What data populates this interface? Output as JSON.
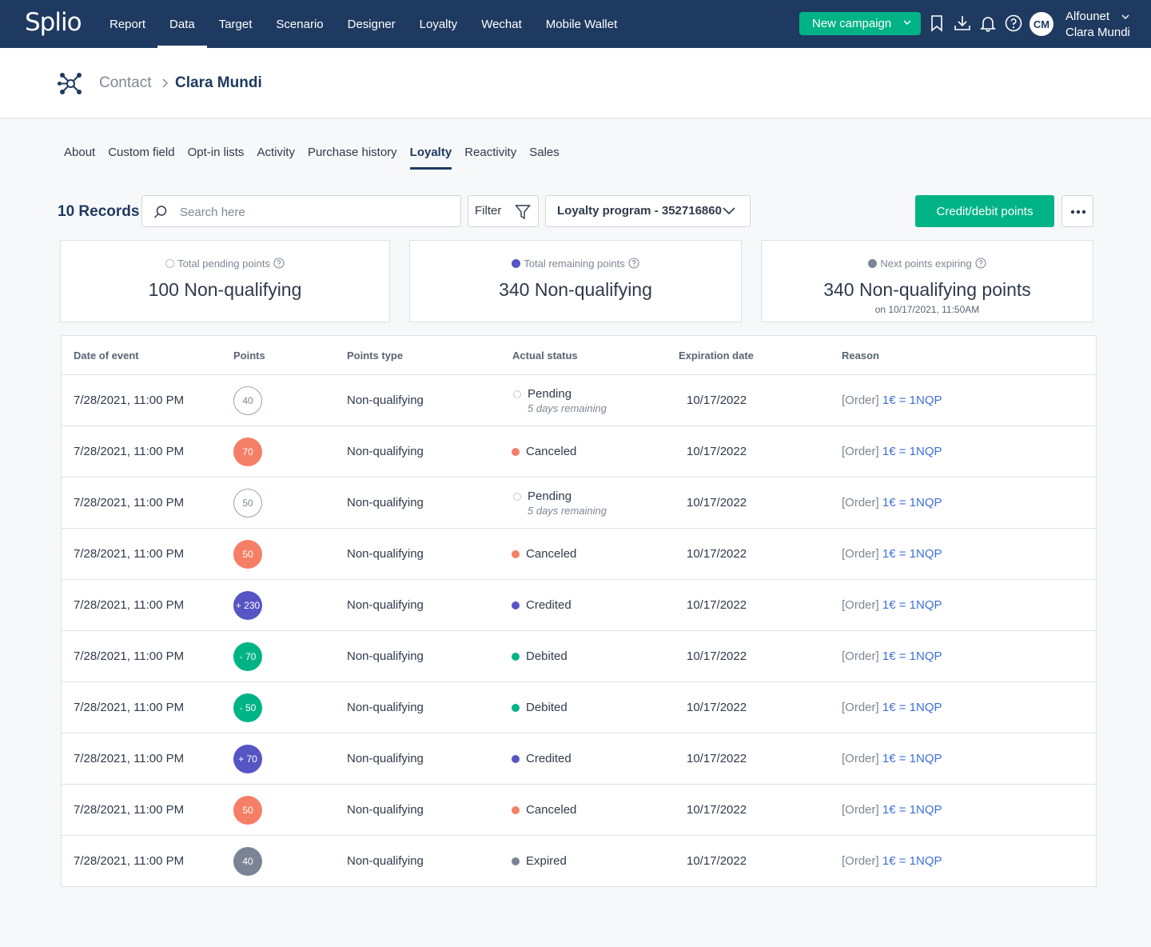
{
  "app": {
    "logo": "Splio"
  },
  "nav": {
    "items": [
      {
        "label": "Report",
        "active": false
      },
      {
        "label": "Data",
        "active": true
      },
      {
        "label": "Target",
        "active": false
      },
      {
        "label": "Scenario",
        "active": false
      },
      {
        "label": "Designer",
        "active": false
      },
      {
        "label": "Loyalty",
        "active": false
      },
      {
        "label": "Wechat",
        "active": false
      },
      {
        "label": "Mobile Wallet",
        "active": false
      }
    ],
    "new_campaign": "New campaign",
    "avatar_initials": "CM",
    "user_org": "Alfounet",
    "user_name": "Clara Mundi"
  },
  "breadcrumb": {
    "parent": "Contact",
    "current": "Clara Mundi"
  },
  "tabs": [
    {
      "label": "About",
      "active": false
    },
    {
      "label": "Custom field",
      "active": false
    },
    {
      "label": "Opt-in lists",
      "active": false
    },
    {
      "label": "Activity",
      "active": false
    },
    {
      "label": "Purchase history",
      "active": false
    },
    {
      "label": "Loyalty",
      "active": true
    },
    {
      "label": "Reactivity",
      "active": false
    },
    {
      "label": "Sales",
      "active": false
    }
  ],
  "toolbar": {
    "records": "10 Records",
    "search_placeholder": "Search here",
    "filter_label": "Filter",
    "program_label": "Loyalty program - 352716860",
    "credit_button": "Credit/debit points"
  },
  "cards": [
    {
      "label": "Total pending points",
      "value": "100 Non-qualifying",
      "sub": "",
      "dot": "pending"
    },
    {
      "label": "Total remaining points",
      "value": "340 Non-qualifying",
      "sub": "",
      "dot": "remaining"
    },
    {
      "label": "Next points expiring",
      "value": "340 Non-qualifying points",
      "sub": "on 10/17/2021, 11:50AM",
      "dot": "expiring"
    }
  ],
  "table": {
    "headers": [
      "Date of event",
      "Points",
      "Points type",
      "Actual status",
      "Expiration date",
      "Reason"
    ],
    "rows": [
      {
        "date": "7/28/2021, 11:00 PM",
        "points": "40",
        "kind": "pending",
        "type": "Non-qualifying",
        "status": "Pending",
        "status_sub": "5 days remaining",
        "expiration": "10/17/2022",
        "reason_prefix": "[Order]",
        "reason_link": "1€ = 1NQP"
      },
      {
        "date": "7/28/2021, 11:00 PM",
        "points": "70",
        "kind": "canceled",
        "type": "Non-qualifying",
        "status": "Canceled",
        "status_sub": "",
        "expiration": "10/17/2022",
        "reason_prefix": "[Order]",
        "reason_link": "1€ = 1NQP"
      },
      {
        "date": "7/28/2021, 11:00 PM",
        "points": "50",
        "kind": "pending",
        "type": "Non-qualifying",
        "status": "Pending",
        "status_sub": "5 days remaining",
        "expiration": "10/17/2022",
        "reason_prefix": "[Order]",
        "reason_link": "1€ = 1NQP"
      },
      {
        "date": "7/28/2021, 11:00 PM",
        "points": "50",
        "kind": "canceled",
        "type": "Non-qualifying",
        "status": "Canceled",
        "status_sub": "",
        "expiration": "10/17/2022",
        "reason_prefix": "[Order]",
        "reason_link": "1€ = 1NQP"
      },
      {
        "date": "7/28/2021, 11:00 PM",
        "points": "+ 230",
        "kind": "credited",
        "type": "Non-qualifying",
        "status": "Credited",
        "status_sub": "",
        "expiration": "10/17/2022",
        "reason_prefix": "[Order]",
        "reason_link": "1€ = 1NQP"
      },
      {
        "date": "7/28/2021, 11:00 PM",
        "points": "- 70",
        "kind": "debited",
        "type": "Non-qualifying",
        "status": "Debited",
        "status_sub": "",
        "expiration": "10/17/2022",
        "reason_prefix": "[Order]",
        "reason_link": "1€ = 1NQP"
      },
      {
        "date": "7/28/2021, 11:00 PM",
        "points": "- 50",
        "kind": "debited",
        "type": "Non-qualifying",
        "status": "Debited",
        "status_sub": "",
        "expiration": "10/17/2022",
        "reason_prefix": "[Order]",
        "reason_link": "1€ = 1NQP"
      },
      {
        "date": "7/28/2021, 11:00 PM",
        "points": "+ 70",
        "kind": "credited",
        "type": "Non-qualifying",
        "status": "Credited",
        "status_sub": "",
        "expiration": "10/17/2022",
        "reason_prefix": "[Order]",
        "reason_link": "1€ = 1NQP"
      },
      {
        "date": "7/28/2021, 11:00 PM",
        "points": "50",
        "kind": "canceled",
        "type": "Non-qualifying",
        "status": "Canceled",
        "status_sub": "",
        "expiration": "10/17/2022",
        "reason_prefix": "[Order]",
        "reason_link": "1€ = 1NQP"
      },
      {
        "date": "7/28/2021, 11:00 PM",
        "points": "40",
        "kind": "expired",
        "type": "Non-qualifying",
        "status": "Expired",
        "status_sub": "",
        "expiration": "10/17/2022",
        "reason_prefix": "[Order]",
        "reason_link": "1€ = 1NQP"
      }
    ]
  },
  "colors": {
    "navy": "#1f3a60",
    "accent_green": "#00b386",
    "pending": "#ffffff",
    "canceled": "#f57f66",
    "credited": "#5655c4",
    "debited": "#00b386",
    "expired": "#7b8494",
    "remaining": "#5655c4",
    "expiring": "#7b8494",
    "link": "#3f6fd9"
  }
}
